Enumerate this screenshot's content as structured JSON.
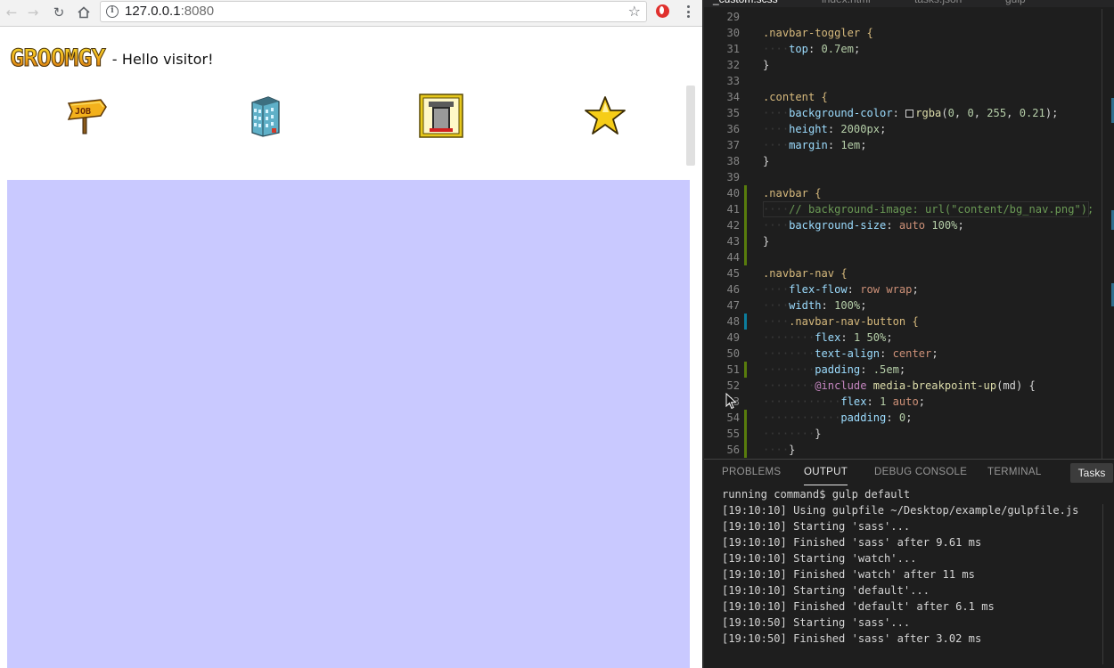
{
  "browser": {
    "url_host": "127.0.0.1",
    "url_port": ":8080",
    "icons": {
      "back": "back-arrow-icon",
      "forward": "forward-arrow-icon",
      "reload": "reload-icon",
      "home": "home-icon",
      "info": "info-icon",
      "bookmark": "star-icon",
      "extension": "opera-icon",
      "menu": "kebab-menu-icon"
    }
  },
  "page": {
    "logo_text": "GROOMGY",
    "greeting": "- Hello visitor!",
    "nav_icons": [
      "job-sign-icon",
      "building-icon",
      "door-icon",
      "star-icon"
    ],
    "content_color": "#c9c9ff"
  },
  "editor": {
    "tabs": [
      "_custom.scss",
      "index.html",
      "tasks.json",
      "gulp"
    ],
    "lines": [
      {
        "n": "29",
        "t": ""
      },
      {
        "n": "30",
        "t": ".navbar-toggler {"
      },
      {
        "n": "31",
        "t": "    top: 0.7em;"
      },
      {
        "n": "32",
        "t": "}"
      },
      {
        "n": "33",
        "t": ""
      },
      {
        "n": "34",
        "t": ".content {"
      },
      {
        "n": "35",
        "t": "    background-color: rgba(0, 0, 255, 0.21);"
      },
      {
        "n": "36",
        "t": "    height: 2000px;"
      },
      {
        "n": "37",
        "t": "    margin: 1em;"
      },
      {
        "n": "38",
        "t": "}"
      },
      {
        "n": "39",
        "t": ""
      },
      {
        "n": "40",
        "t": ".navbar {"
      },
      {
        "n": "41",
        "t": "    // background-image: url(\"content/bg_nav.png\");"
      },
      {
        "n": "42",
        "t": "    background-size: auto 100%;"
      },
      {
        "n": "43",
        "t": "}"
      },
      {
        "n": "44",
        "t": ""
      },
      {
        "n": "45",
        "t": ".navbar-nav {"
      },
      {
        "n": "46",
        "t": "    flex-flow: row wrap;"
      },
      {
        "n": "47",
        "t": "    width: 100%;"
      },
      {
        "n": "48",
        "t": "    .navbar-nav-button {"
      },
      {
        "n": "49",
        "t": "        flex: 1 50%;"
      },
      {
        "n": "50",
        "t": "        text-align: center;"
      },
      {
        "n": "51",
        "t": "        padding: .5em;"
      },
      {
        "n": "52",
        "t": "        @include media-breakpoint-up(md) {"
      },
      {
        "n": "53",
        "t": "            flex: 1 auto;"
      },
      {
        "n": "54",
        "t": "            padding: 0;"
      },
      {
        "n": "55",
        "t": "        }"
      },
      {
        "n": "56",
        "t": "    }"
      }
    ]
  },
  "panel": {
    "tabs": [
      "PROBLEMS",
      "OUTPUT",
      "DEBUG CONSOLE",
      "TERMINAL"
    ],
    "active_tab": "OUTPUT",
    "task_selector": "Tasks",
    "output_lines": [
      "running command$ gulp default",
      "[19:10:10] Using gulpfile ~/Desktop/example/gulpfile.js",
      "[19:10:10] Starting 'sass'...",
      "[19:10:10] Finished 'sass' after 9.61 ms",
      "[19:10:10] Starting 'watch'...",
      "[19:10:10] Finished 'watch' after 11 ms",
      "[19:10:10] Starting 'default'...",
      "[19:10:10] Finished 'default' after 6.1 ms",
      "[19:10:50] Starting 'sass'...",
      "[19:10:50] Finished 'sass' after 3.02 ms"
    ]
  },
  "colors": {
    "content_bg": "#c9c9ff",
    "editor_bg": "#1e1e1e",
    "gutter_modified": "#587c0c",
    "gutter_changed": "#0c7d9d"
  }
}
